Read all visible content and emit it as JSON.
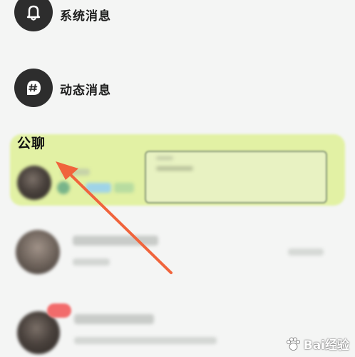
{
  "messages": {
    "system_label": "系统消息",
    "dynamic_label": "动态消息"
  },
  "group_chat": {
    "title": "公聊"
  },
  "watermark": {
    "text": "Bai经验"
  },
  "colors": {
    "highlight": "#e2f1a4",
    "arrow": "#f0643c",
    "icon_bg": "#2d2d2d",
    "badge": "#f26b6b"
  }
}
